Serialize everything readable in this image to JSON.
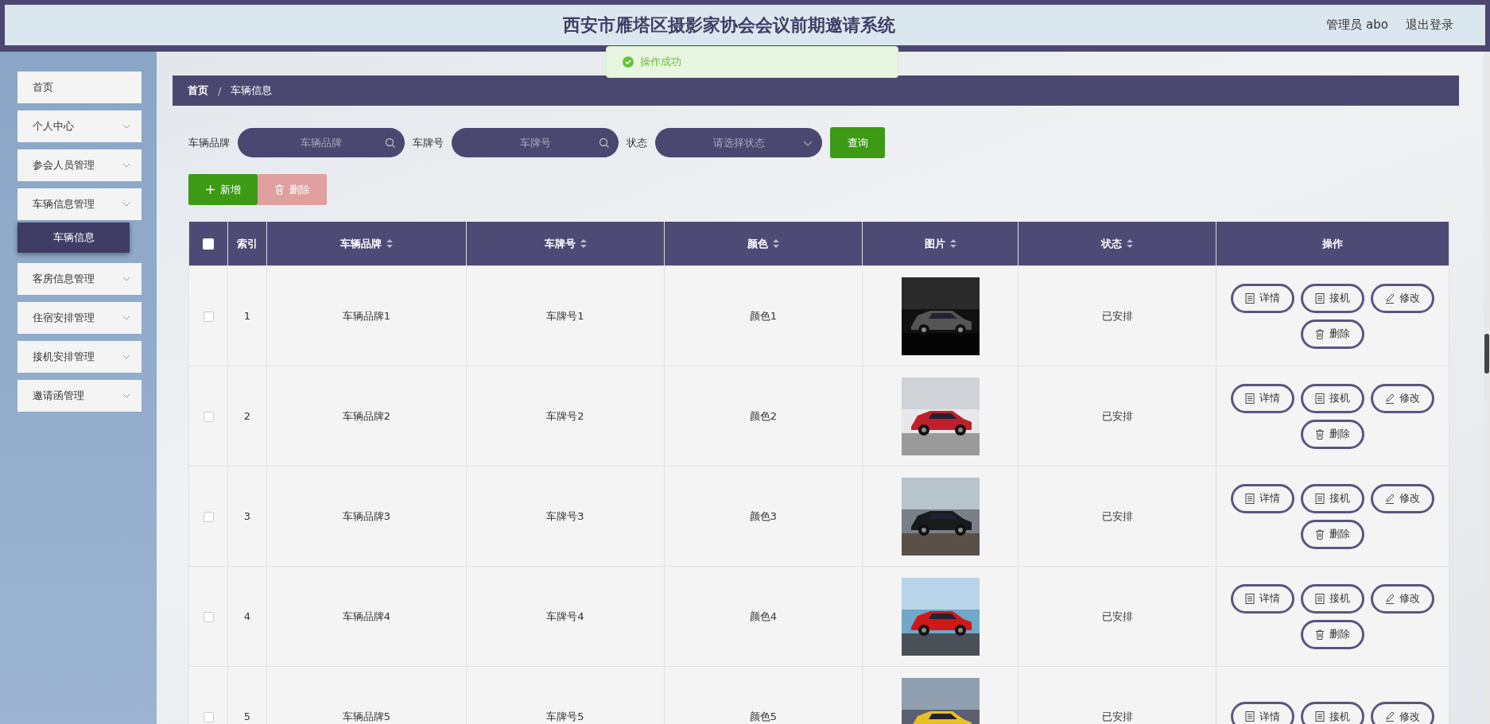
{
  "header": {
    "title": "西安市雁塔区摄影家协会会议前期邀请系统",
    "user": "管理员 abo",
    "logout": "退出登录"
  },
  "toast": {
    "message": "操作成功"
  },
  "sidebar": {
    "items": [
      {
        "label": "首页",
        "kind": "link"
      },
      {
        "label": "个人中心",
        "kind": "submenu"
      },
      {
        "label": "参会人员管理",
        "kind": "submenu"
      },
      {
        "label": "车辆信息管理",
        "kind": "submenu",
        "children": [
          {
            "label": "车辆信息",
            "selected": true
          }
        ]
      },
      {
        "label": "客房信息管理",
        "kind": "submenu"
      },
      {
        "label": "住宿安排管理",
        "kind": "submenu"
      },
      {
        "label": "接机安排管理",
        "kind": "submenu"
      },
      {
        "label": "邀请函管理",
        "kind": "submenu"
      }
    ]
  },
  "breadcrumb": {
    "separator": "/",
    "items": [
      "首页",
      "车辆信息"
    ]
  },
  "search": {
    "fields": [
      {
        "label": "车辆品牌",
        "placeholder": "车辆品牌",
        "kind": "text"
      },
      {
        "label": "车牌号",
        "placeholder": "车牌号",
        "kind": "text"
      },
      {
        "label": "状态",
        "placeholder": "请选择状态",
        "kind": "select"
      }
    ],
    "button": "查询"
  },
  "actions": [
    {
      "label": "新增",
      "kind": "add",
      "disabled": false
    },
    {
      "label": "删除",
      "kind": "delete",
      "disabled": true
    }
  ],
  "table": {
    "select_all_checked": false,
    "columns": [
      {
        "label": "索引",
        "sortable": false
      },
      {
        "label": "车辆品牌",
        "sortable": true
      },
      {
        "label": "车牌号",
        "sortable": true
      },
      {
        "label": "颜色",
        "sortable": true
      },
      {
        "label": "图片",
        "sortable": true
      },
      {
        "label": "状态",
        "sortable": true
      },
      {
        "label": "操作",
        "sortable": false
      }
    ],
    "rows": [
      {
        "checked": false,
        "index": "1",
        "brand": "车辆品牌1",
        "plate": "车牌号1",
        "vehicle_color": "颜色1",
        "status": "已安排",
        "buttons": [
          {
            "label": "详情",
            "kind": "detail"
          },
          {
            "label": "接机",
            "kind": "pickup"
          },
          {
            "label": "修改",
            "kind": "edit"
          },
          {
            "label": "删除",
            "kind": "delete"
          }
        ]
      },
      {
        "checked": false,
        "index": "2",
        "brand": "车辆品牌2",
        "plate": "车牌号2",
        "vehicle_color": "颜色2",
        "status": "已安排",
        "buttons": [
          {
            "label": "详情",
            "kind": "detail"
          },
          {
            "label": "接机",
            "kind": "pickup"
          },
          {
            "label": "修改",
            "kind": "edit"
          },
          {
            "label": "删除",
            "kind": "delete"
          }
        ]
      },
      {
        "checked": false,
        "index": "3",
        "brand": "车辆品牌3",
        "plate": "车牌号3",
        "vehicle_color": "颜色3",
        "status": "已安排",
        "buttons": [
          {
            "label": "详情",
            "kind": "detail"
          },
          {
            "label": "接机",
            "kind": "pickup"
          },
          {
            "label": "修改",
            "kind": "edit"
          },
          {
            "label": "删除",
            "kind": "delete"
          }
        ]
      },
      {
        "checked": false,
        "index": "4",
        "brand": "车辆品牌4",
        "plate": "车牌号4",
        "vehicle_color": "颜色4",
        "status": "已安排",
        "buttons": [
          {
            "label": "详情",
            "kind": "detail"
          },
          {
            "label": "接机",
            "kind": "pickup"
          },
          {
            "label": "修改",
            "kind": "edit"
          },
          {
            "label": "删除",
            "kind": "delete"
          }
        ]
      },
      {
        "checked": false,
        "index": "5",
        "brand": "车辆品牌5",
        "plate": "车牌号5",
        "vehicle_color": "颜色5",
        "status": "已安排",
        "buttons": [
          {
            "label": "详情",
            "kind": "detail"
          },
          {
            "label": "接机",
            "kind": "pickup"
          },
          {
            "label": "修改",
            "kind": "edit"
          }
        ]
      }
    ]
  }
}
